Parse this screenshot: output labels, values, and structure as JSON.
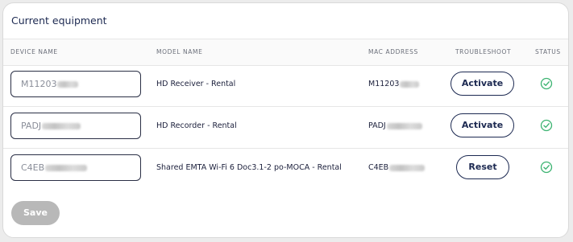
{
  "title": "Current equipment",
  "columns": {
    "device_name": "DEVICE NAME",
    "model_name": "MODEL NAME",
    "mac_address": "MAC ADDRESS",
    "troubleshoot": "TROUBLESHOOT",
    "status": "STATUS"
  },
  "rows": [
    {
      "device_value": "M11203",
      "model": "HD Receiver - Rental",
      "mac": "M11203",
      "action": "Activate",
      "status_icon": "check-circle-icon"
    },
    {
      "device_value": "PADJ",
      "model": "HD Recorder - Rental",
      "mac": "PADJ",
      "action": "Activate",
      "status_icon": "check-circle-icon"
    },
    {
      "device_value": "C4EB",
      "model": "Shared EMTA Wi-Fi 6 Doc3.1-2 po-MOCA - Rental",
      "mac": "C4EB",
      "action": "Reset",
      "status_icon": "check-circle-icon"
    }
  ],
  "save_label": "Save",
  "colors": {
    "accent": "#1c2951",
    "status_green": "#3cb371",
    "save_disabled": "#b8b8b8"
  }
}
